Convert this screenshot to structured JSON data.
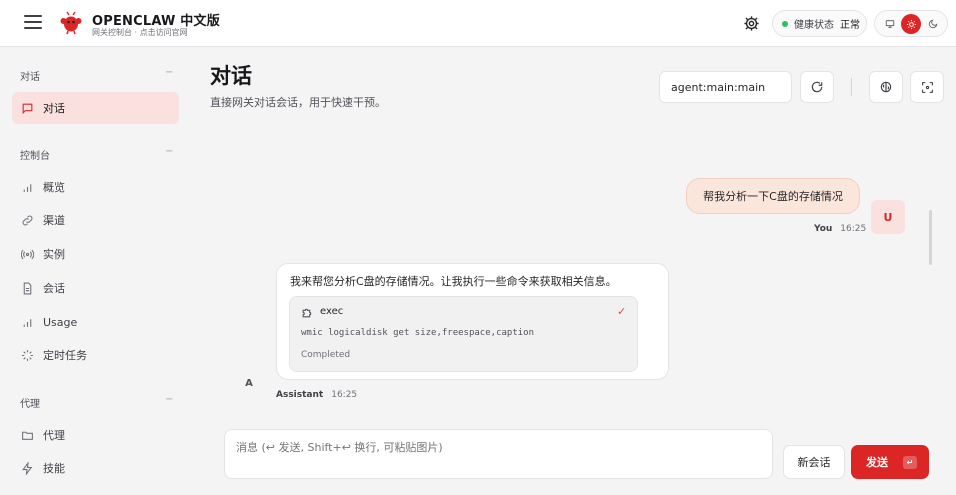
{
  "header": {
    "brand_title": "OPENCLAW 中文版",
    "brand_subtitle": "网关控制台 · 点击访问官网",
    "health_label": "健康状态",
    "health_value": "正常",
    "health_color": "#22c55e",
    "accent_color": "#dc2626",
    "icons": [
      "menu-icon",
      "lobster-logo-icon",
      "gear-icon",
      "monitor-icon",
      "sun-icon",
      "moon-icon"
    ]
  },
  "sidebar": {
    "groups": [
      {
        "title": "对话",
        "items": [
          {
            "label": "对话",
            "icon": "message-icon",
            "active": true
          }
        ]
      },
      {
        "title": "控制台",
        "items": [
          {
            "label": "概览",
            "icon": "bar-chart-icon"
          },
          {
            "label": "渠道",
            "icon": "link-icon"
          },
          {
            "label": "实例",
            "icon": "radio-icon"
          },
          {
            "label": "会话",
            "icon": "file-icon"
          },
          {
            "label": "Usage",
            "icon": "bar-chart-icon"
          },
          {
            "label": "定时任务",
            "icon": "loader-icon"
          }
        ]
      },
      {
        "title": "代理",
        "items": [
          {
            "label": "代理",
            "icon": "folder-icon"
          },
          {
            "label": "技能",
            "icon": "zap-icon"
          }
        ]
      }
    ],
    "collapse_glyph": "−"
  },
  "main": {
    "title": "对话",
    "subtitle": "直接网关对话会话，用于快速干预。",
    "session_key": "agent:main:main"
  },
  "chat": {
    "user_message": "帮我分析一下C盘的存储情况",
    "user_avatar": "U",
    "user_name": "You",
    "user_time": "16:25",
    "assistant_message": "我来帮您分析C盘的存储情况。让我执行一些命令来获取相关信息。",
    "tool": {
      "name": "exec",
      "command": "wmic logicaldisk get size,freespace,caption",
      "status": "Completed"
    },
    "assistant_avatar": "A",
    "assistant_name": "Assistant",
    "assistant_time": "16:25"
  },
  "composer": {
    "placeholder": "消息 (↩ 发送, Shift+↩ 换行, 可粘贴图片)",
    "new_session_label": "新会话",
    "send_label": "发送",
    "send_hint": "↵"
  }
}
